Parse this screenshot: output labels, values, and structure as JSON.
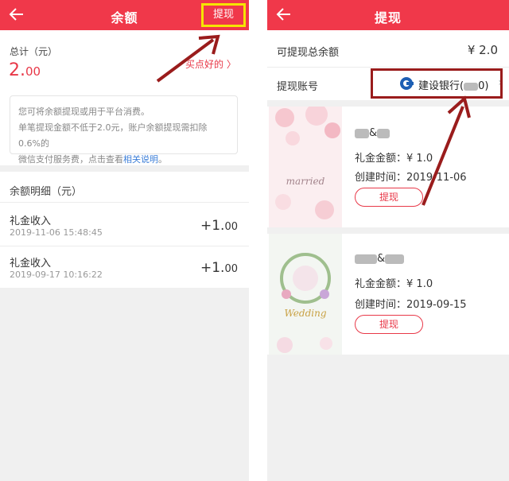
{
  "left": {
    "header": {
      "title": "余额",
      "withdraw_label": "提现"
    },
    "total_label": "总计（元）",
    "total_int": "2.",
    "total_dec": "00",
    "hint_link": "买点好的 〉",
    "notice": {
      "line1": "您可将余额提现或用于平台消费。",
      "line2": "单笔提现金额不低于2.0元，账户余额提现需扣除0.6%的",
      "line3_prefix": "微信支付服务费，点击查看",
      "line3_link": "相关说明",
      "line3_suffix": "。"
    },
    "detail_title": "余额明细（元）",
    "records": [
      {
        "title": "礼金收入",
        "time": "2019-11-06 15:48:45",
        "amount_int": "+1.",
        "amount_dec": "00"
      },
      {
        "title": "礼金收入",
        "time": "2019-09-17 10:16:22",
        "amount_int": "+1.",
        "amount_dec": "00"
      }
    ]
  },
  "right": {
    "header": {
      "title": "提现"
    },
    "balance_label": "可提现总余额",
    "balance_value": "¥ 2.0",
    "account_label": "提现账号",
    "account_bank": "建设银行(",
    "account_tail": "0)",
    "cards": [
      {
        "name_tail": "&",
        "gift_label": "礼金金额：",
        "gift_value": "¥ 1.0",
        "created_label": "创建时间：",
        "created_value": "2019-11-06",
        "button": "提现",
        "thumb_text": "married"
      },
      {
        "name_tail": "&",
        "gift_label": "礼金金额：",
        "gift_value": "¥ 1.0",
        "created_label": "创建时间：",
        "created_value": "2019-09-15",
        "button": "提现",
        "thumb_text": "Wedding"
      }
    ]
  },
  "colors": {
    "brand": "#f0384a",
    "highlight_yellow": "#f5e400",
    "annotation": "#9a1c1c",
    "link": "#3b7ed8"
  }
}
